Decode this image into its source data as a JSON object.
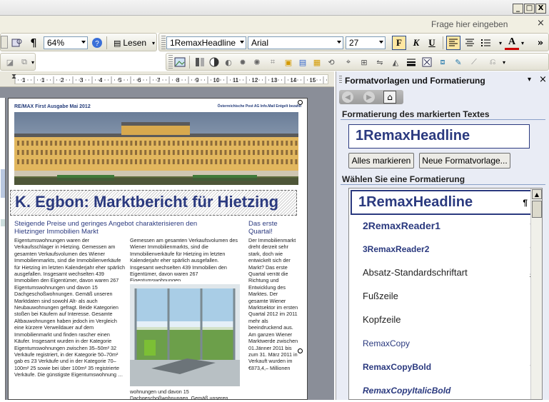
{
  "window": {
    "minimize": "_",
    "maximize": "□",
    "close": "X"
  },
  "help": {
    "placeholder": "Frage hier eingeben",
    "close": "×"
  },
  "toolbar_top": {
    "zoom": "64%",
    "read_label": "Lesen",
    "style_combo": "1RemaxHeadline",
    "font_combo": "Arial",
    "size_combo": "27",
    "bold": "F",
    "italic": "K",
    "underline": "U",
    "font_color": "A"
  },
  "ruler": {
    "numbers": [
      "1",
      "1",
      "2",
      "3",
      "4",
      "5",
      "6",
      "7",
      "8",
      "9",
      "10",
      "11",
      "12",
      "13",
      "14",
      "15"
    ]
  },
  "document": {
    "header_left": "RE/MAX First Ausgabe Mai 2012",
    "header_right": "Österreichische Post AG Info.Mail Entgelt bezahlt",
    "headline": "K. Egbon: Marktbericht für Hietzing",
    "subhead": "Steigende Preise und geringes Angebot charakterisieren den Hietzinger Immobilien Markt",
    "side_title": "Das erste Quartal!",
    "col1": "Eigentumswohnungen waren der Verkaufsschlager in Hietzing. Gemessen am gesamten Verkaufsvolumen des Wiener Immobilienmarkts, sind die Immobilienverkäufe für Hietzing im letzten Kalenderjahr eher spärlich ausgefallen. Insgesamt wechselten 439 Immobilien den Eigentümer, davon waren 267 Eigentumswohnungen und davon 15 Dachgeschoßwohnungen. Gemäß unseren Marktdaten sind sowohl Alt- als auch Neubauwohnungen gefragt. Beide Kategorien stoßen bei Käufern auf Interesse. Gesamte Altbauwohnungen haben jedoch im Vergleich eine kürzere Verweildauer auf dem Immobilienmarkt und finden rascher einen Käufer. Insgesamt wurden in der Kategorie Eigentumswohnungen zwischen 35–50m² 32 Verkäufe registriert, in der Kategorie 50–70m² gab es 23 Verkäufe und in der Kategorie 70–100m² 25 sowie bei über 100m² 35 registrierte Verkäufe. Die günstigste Eigentumswohnung …",
    "col2": "Gemessen am gesamten Verkaufsvolumen des Wiener Immobilienmarkts, sind die Immobilienverkäufe für Hietzing im letzten Kalenderjahr eher spärlich ausgefallen. Insgesamt wechselten 439 Immobilien den Eigentümer, davon waren 267 Eigentumswohnungen …",
    "col2_bottom": "wohnungen und davon 15 Dachgeschoßwohnungen. Gemäß unseren Marktdaten sind",
    "col3": "Der Immobilienmarkt dreht derzeit sehr stark, doch wie entwickelt sich der Markt? Das erste Quartal verrät die Richtung und Entwicklung des Marktes. Der gesamte Wiener Marktsektor im ersten Quartal 2012 im 2011 mehr als beeindruckend aus. Am ganzen Wiener Marktwerde zwischen 01.Jänner 2011 bis zum 31. März 2011 in Verkauft wurden im €873,4,– Millionen"
  },
  "pane": {
    "title": "Formatvorlagen und Formatierung",
    "section1": "Formatierung des markierten Textes",
    "current_style": "1RemaxHeadline",
    "btn_select_all": "Alles markieren",
    "btn_new_style": "Neue Formatvorlage...",
    "section2": "Wählen Sie eine Formatierung",
    "styles": [
      {
        "name": "1RemaxHeadline",
        "mark": "¶"
      },
      {
        "name": "2RemaxReader1",
        "mark": "¶"
      },
      {
        "name": "3RemaxReader2",
        "mark": "¶"
      },
      {
        "name": "Absatz-Standardschriftart",
        "mark": "a"
      },
      {
        "name": "Fußzeile",
        "mark": "¶"
      },
      {
        "name": "Kopfzeile",
        "mark": "¶"
      },
      {
        "name": "RemaxCopy",
        "mark": "¶"
      },
      {
        "name": "RemaxCopyBold",
        "mark": "¶"
      },
      {
        "name": "RemaxCopyItalicBold",
        "mark": "¶"
      }
    ]
  },
  "colors": {
    "accent": "#2b3a7f",
    "pane_bg": "#e9ecf5",
    "toolbar_bg": "#ece9d8"
  }
}
